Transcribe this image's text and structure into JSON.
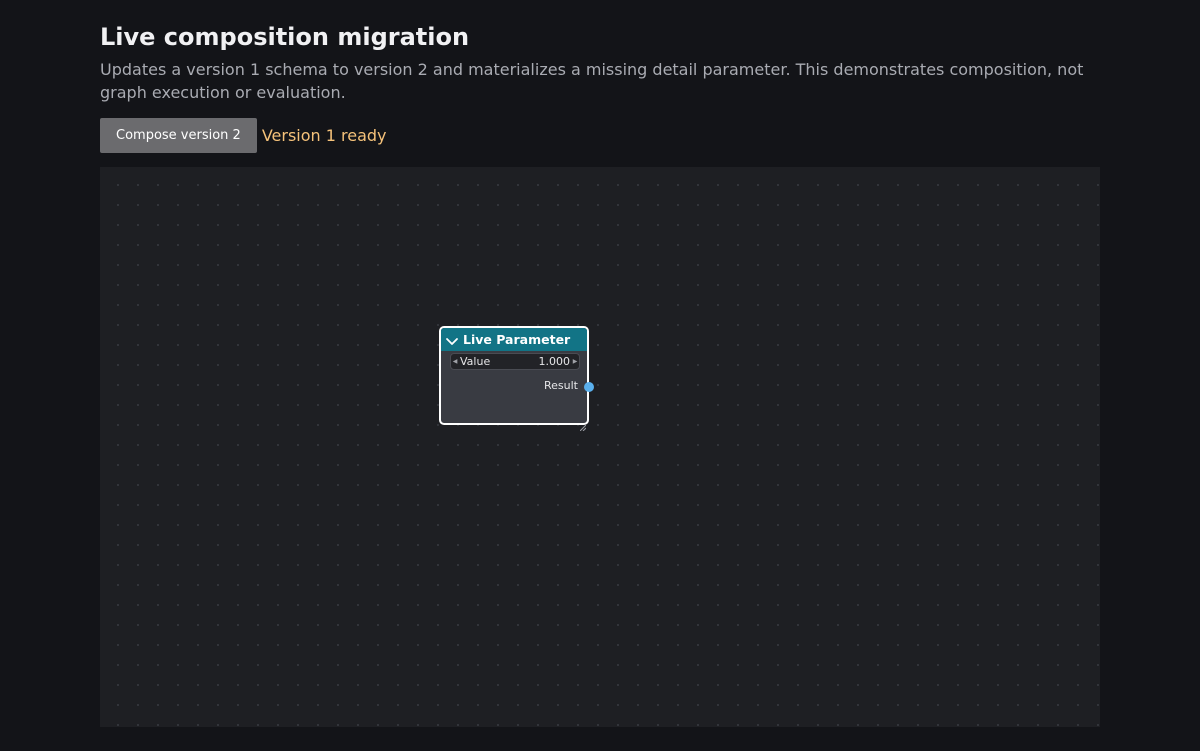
{
  "header": {
    "title": "Live composition migration",
    "description": "Updates a version 1 schema to version 2 and materializes a missing detail parameter. This demonstrates composition, not graph execution or evaluation."
  },
  "toolbar": {
    "compose_label": "Compose version 2",
    "status_text": "Version 1 ready"
  },
  "node": {
    "title": "Live Parameter",
    "collapse_icon": "chevron-down-icon",
    "field_label": "Value",
    "field_value": "1.000",
    "output_label": "Result",
    "header_color": "#127486",
    "socket_color": "#5ab0ee"
  },
  "colors": {
    "status": "#f5c27a",
    "button": "#6b6b6e",
    "background": "#131418",
    "canvas": "#1e1f23"
  }
}
